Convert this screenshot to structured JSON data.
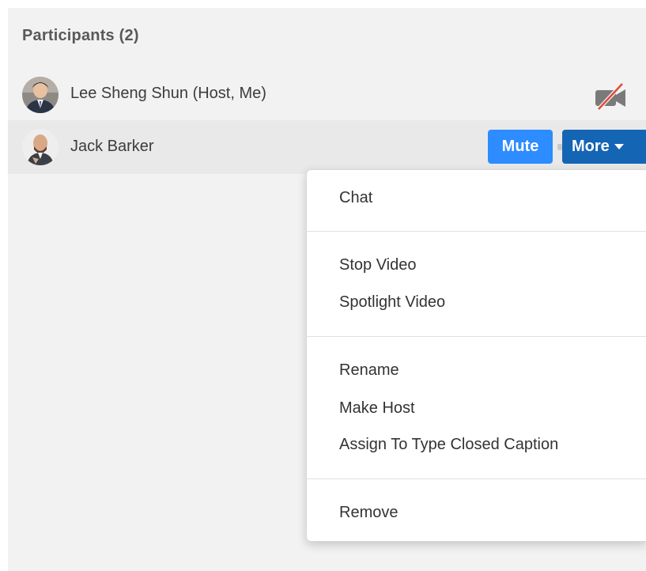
{
  "panel": {
    "title": "Participants (2)"
  },
  "participants": [
    {
      "name": "Lee Sheng Shun (Host, Me)",
      "avatar_icon": "person-photo-avatar",
      "status_icon": "video-off-icon"
    },
    {
      "name": "Jack Barker",
      "avatar_icon": "person-photo-avatar",
      "actions": {
        "mute_label": "Mute",
        "more_label": "More"
      }
    }
  ],
  "more_menu": {
    "items": [
      "Chat",
      "Stop Video",
      "Spotlight Video",
      "Rename",
      "Make Host",
      "Assign To Type Closed Caption",
      "Remove"
    ]
  },
  "colors": {
    "panel_bg": "#f2f2f2",
    "hover_row_bg": "#e9e9e9",
    "mute_button": "#2d8cff",
    "more_button": "#1565b5",
    "video_off_slash": "#e04a3a"
  }
}
